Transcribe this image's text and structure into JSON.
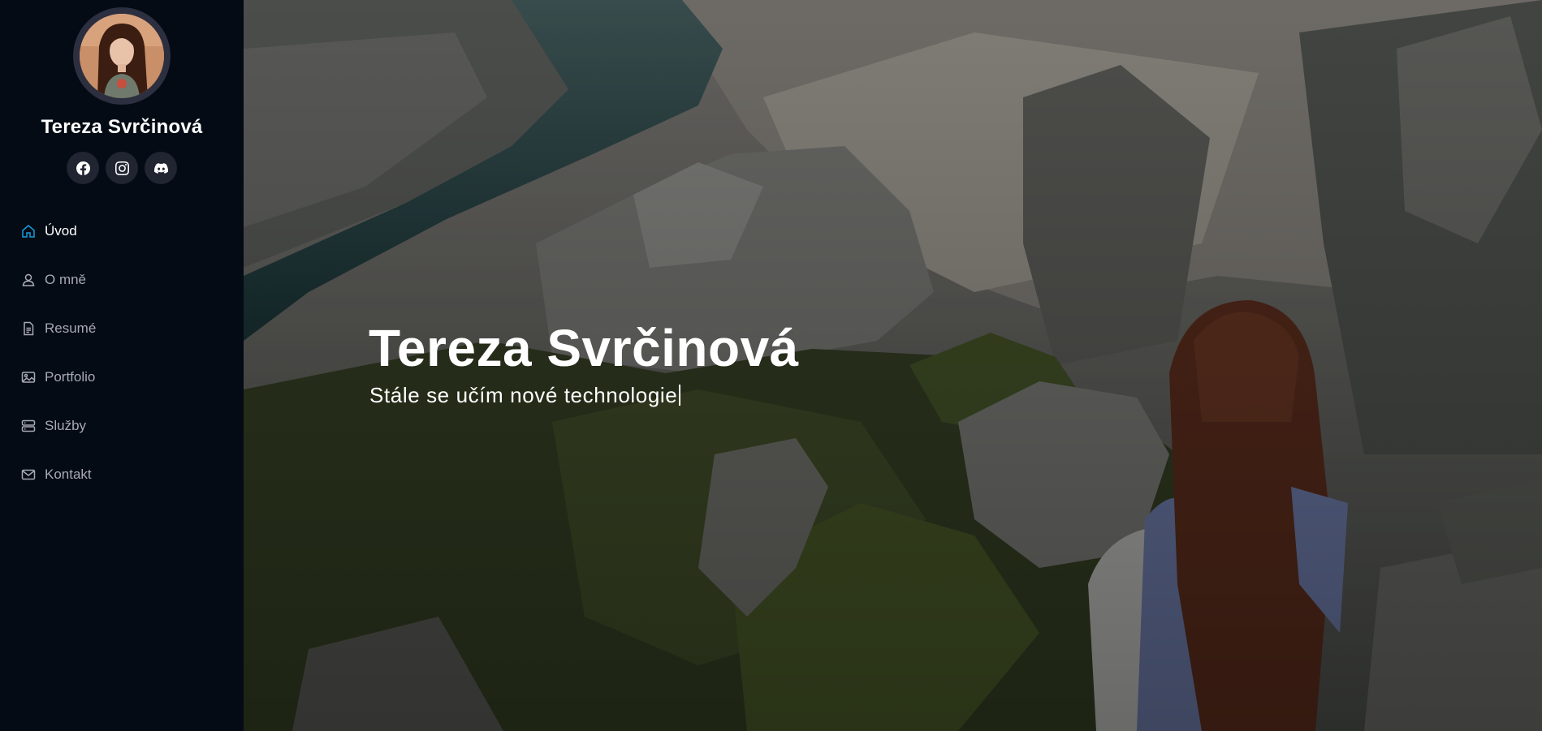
{
  "profile": {
    "name": "Tereza Svrčinová",
    "avatar_icon": "portrait-photo"
  },
  "socials": [
    {
      "name": "facebook",
      "icon": "facebook-icon"
    },
    {
      "name": "instagram",
      "icon": "instagram-icon"
    },
    {
      "name": "discord",
      "icon": "discord-icon"
    }
  ],
  "nav": {
    "items": [
      {
        "label": "Úvod",
        "icon": "home-icon",
        "active": true
      },
      {
        "label": "O mně",
        "icon": "person-icon",
        "active": false
      },
      {
        "label": "Resumé",
        "icon": "file-icon",
        "active": false
      },
      {
        "label": "Portfolio",
        "icon": "images-icon",
        "active": false
      },
      {
        "label": "Služby",
        "icon": "server-icon",
        "active": false
      },
      {
        "label": "Kontakt",
        "icon": "envelope-icon",
        "active": false
      }
    ]
  },
  "hero": {
    "title": "Tereza Svrčinová",
    "subtitle": "Stále se učím nové technologie"
  },
  "colors": {
    "sidebar_bg": "#040b14",
    "accent": "#149ddd",
    "nav_text": "#a8a9b4",
    "social_bg": "#212431"
  }
}
